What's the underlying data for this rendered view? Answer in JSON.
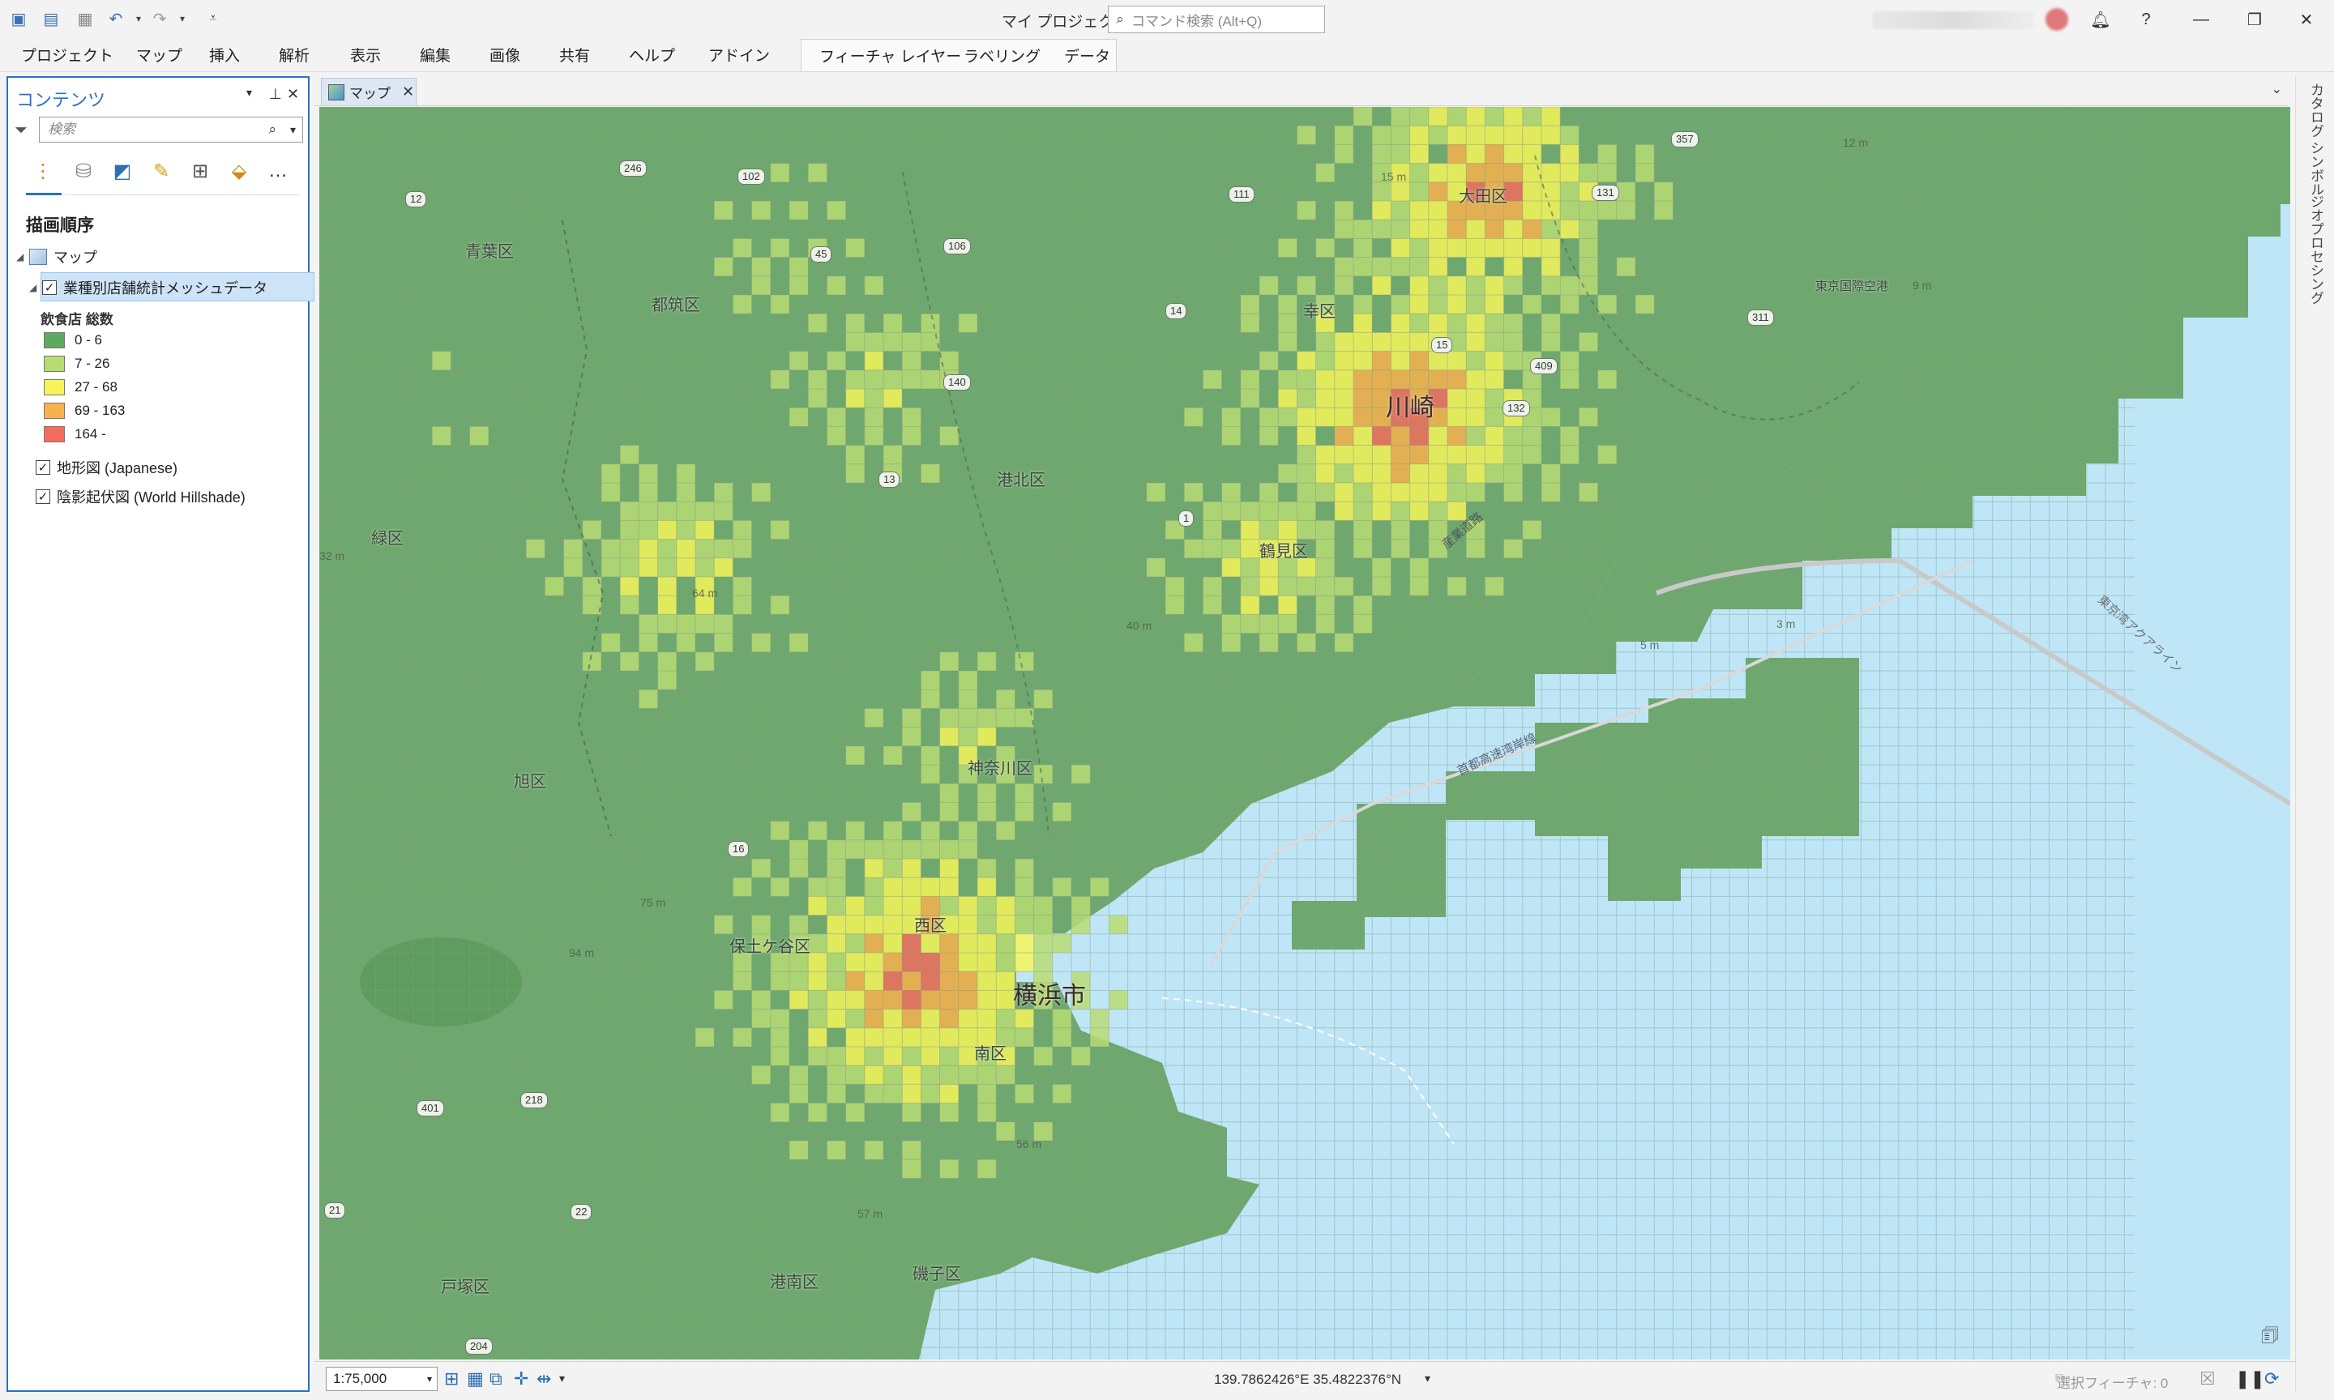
{
  "app": {
    "project_title": "マイ プロジェクト",
    "command_search_placeholder": "コマンド検索 (Alt+Q)"
  },
  "ribbon": {
    "tabs": [
      "プロジェクト",
      "マップ",
      "挿入",
      "解析",
      "表示",
      "編集",
      "画像",
      "共有",
      "ヘルプ",
      "アドイン"
    ],
    "contextual_tabs": [
      "フィーチャ レイヤー",
      "ラベリング",
      "データ"
    ]
  },
  "contents": {
    "title": "コンテンツ",
    "search_placeholder": "検索",
    "section_title": "描画順序",
    "map_node": "マップ",
    "layers": [
      {
        "name": "業種別店舗統計メッシュデータ",
        "checked": true,
        "selected": true
      },
      {
        "name": "地形図 (Japanese)",
        "checked": true
      },
      {
        "name": "陰影起伏図 (World Hillshade)",
        "checked": true
      }
    ],
    "legend": {
      "title": "飲食店 総数",
      "classes": [
        {
          "label": "0 - 6",
          "color": "#5fa85f"
        },
        {
          "label": "7 - 26",
          "color": "#b8dc74"
        },
        {
          "label": "27 - 68",
          "color": "#f6f45a"
        },
        {
          "label": "69 - 163",
          "color": "#f7b24e"
        },
        {
          "label": "164 -",
          "color": "#f26c5e"
        }
      ]
    }
  },
  "map_tab": {
    "label": "マップ"
  },
  "map": {
    "water_color": "#bfe6f7",
    "places": [
      "青葉区",
      "都筑区",
      "港北区",
      "緑区",
      "旭区",
      "神奈川区",
      "保土ケ谷区",
      "西区",
      "南区",
      "港南区",
      "磯子区",
      "戸塚区",
      "大田区",
      "幸区",
      "鶴見区",
      "川崎",
      "横浜市",
      "東京国際空港"
    ],
    "routes": [
      "12",
      "246",
      "102",
      "45",
      "106",
      "111",
      "140",
      "14",
      "13",
      "15",
      "409",
      "132",
      "311",
      "357",
      "131",
      "1",
      "16",
      "218",
      "401",
      "22",
      "21",
      "204"
    ],
    "elevations": [
      "12 m",
      "15 m",
      "9 m",
      "64 m",
      "75 m",
      "94 m",
      "40 m",
      "5 m",
      "3 m",
      "56 m",
      "57 m",
      "32 m"
    ],
    "road_labels": [
      "東京湾アクアライン",
      "首都高速湾岸線",
      "産業道路"
    ]
  },
  "status": {
    "scale": "1:75,000",
    "coordinates": "139.7862426°E 35.4822376°N",
    "selected_features": "選択フィーチャ: 0"
  },
  "right_rail": [
    "カタログ",
    "シンボル",
    "ジオプロセシング"
  ]
}
